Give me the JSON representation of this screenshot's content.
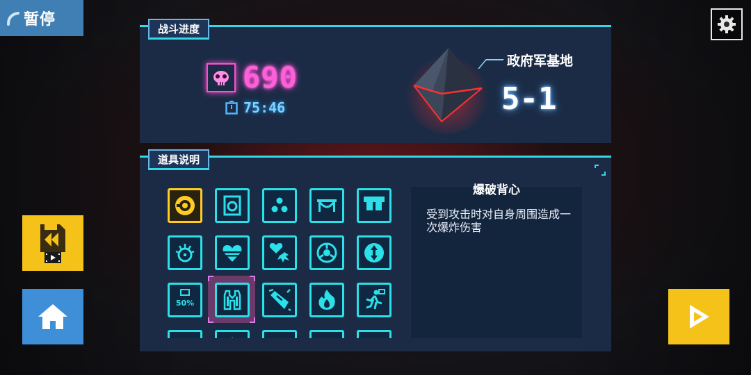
{
  "hud": {
    "pause_label": "暂停"
  },
  "battle": {
    "title": "战斗进度",
    "kill_count": "690",
    "time": "75:46",
    "location": "政府军基地",
    "stage": "5-1"
  },
  "items": {
    "title": "道具说明",
    "selected_name": "爆破背心",
    "selected_desc": "受到攻击时对自身周围造成一次爆炸伤害",
    "grid": [
      {
        "icon": "saw-blade-icon",
        "state": "gold"
      },
      {
        "icon": "steering-card-icon",
        "state": "normal"
      },
      {
        "icon": "three-dots-icon",
        "state": "normal"
      },
      {
        "icon": "bench-icon",
        "state": "normal"
      },
      {
        "icon": "jaw-icon",
        "state": "normal"
      },
      {
        "icon": "spiked-target-icon",
        "state": "normal"
      },
      {
        "icon": "heart-stripe-icon",
        "state": "normal"
      },
      {
        "icon": "heart-burst-icon",
        "state": "normal"
      },
      {
        "icon": "tri-target-icon",
        "state": "normal"
      },
      {
        "icon": "arrows-circle-icon",
        "state": "normal"
      },
      {
        "icon": "percent-50-icon",
        "state": "normal",
        "text": "50%"
      },
      {
        "icon": "vest-icon",
        "state": "selected"
      },
      {
        "icon": "fist-impact-icon",
        "state": "normal"
      },
      {
        "icon": "flame-icon",
        "state": "normal"
      },
      {
        "icon": "running-man-icon",
        "state": "normal"
      },
      {
        "icon": "partial-icon-1",
        "state": "normal"
      },
      {
        "icon": "partial-icon-2",
        "state": "normal"
      },
      {
        "icon": "partial-icon-3",
        "state": "normal"
      },
      {
        "icon": "partial-icon-4",
        "state": "normal"
      },
      {
        "icon": "partial-icon-5",
        "state": "normal"
      }
    ]
  },
  "colors": {
    "accent_cyan": "#2be0e8",
    "kill_pink": "#ff5fd8",
    "timer_blue": "#7fd1ff",
    "gold": "#f5c21a",
    "home_blue": "#3e8ed8"
  }
}
